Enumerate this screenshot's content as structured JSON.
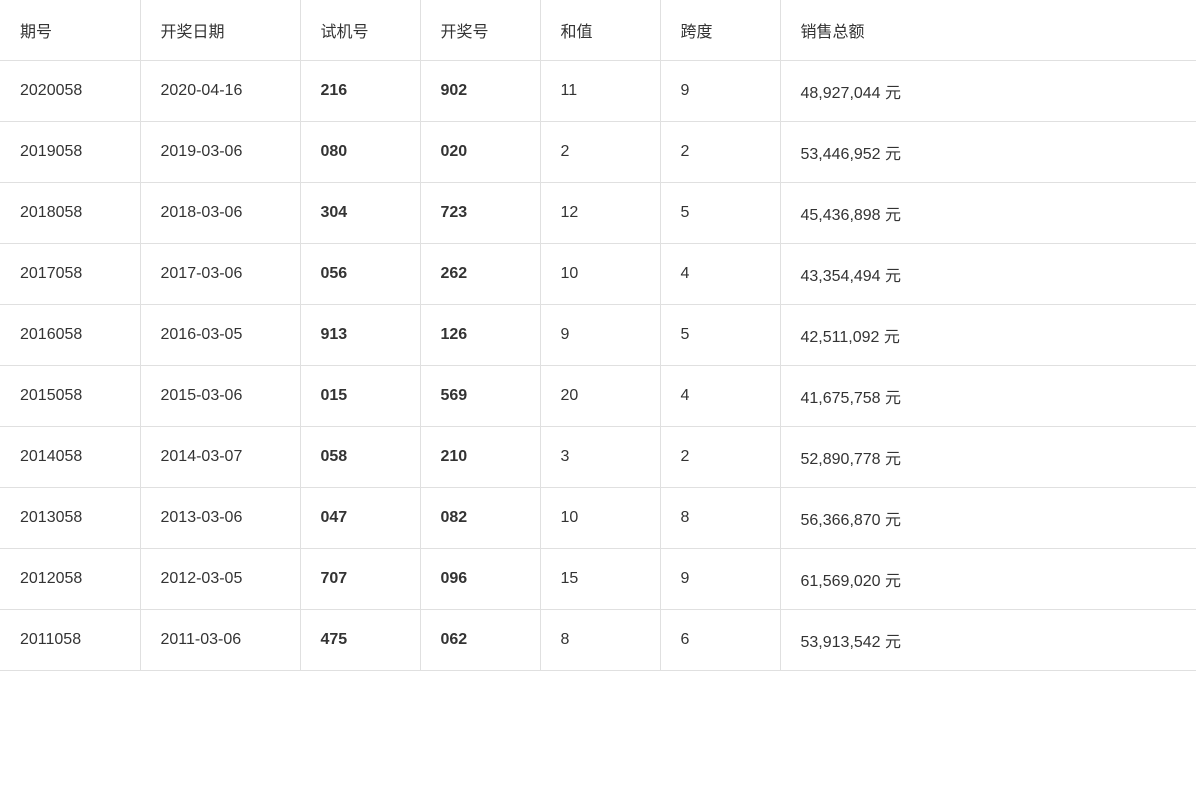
{
  "table": {
    "columns": [
      {
        "id": "qihao",
        "label": "期号"
      },
      {
        "id": "date",
        "label": "开奖日期"
      },
      {
        "id": "shijihao",
        "label": "试机号"
      },
      {
        "id": "kaijianghao",
        "label": "开奖号"
      },
      {
        "id": "hezhi",
        "label": "和值"
      },
      {
        "id": "kuadu",
        "label": "跨度"
      },
      {
        "id": "xiaoshou",
        "label": "销售总额"
      }
    ],
    "rows": [
      {
        "qihao": "2020058",
        "date": "2020-04-16",
        "shijihao": "216",
        "kaijianghao": "902",
        "hezhi": "11",
        "kuadu": "9",
        "xiaoshou": "48,927,044 元"
      },
      {
        "qihao": "2019058",
        "date": "2019-03-06",
        "shijihao": "080",
        "kaijianghao": "020",
        "hezhi": "2",
        "kuadu": "2",
        "xiaoshou": "53,446,952 元"
      },
      {
        "qihao": "2018058",
        "date": "2018-03-06",
        "shijihao": "304",
        "kaijianghao": "723",
        "hezhi": "12",
        "kuadu": "5",
        "xiaoshou": "45,436,898 元"
      },
      {
        "qihao": "2017058",
        "date": "2017-03-06",
        "shijihao": "056",
        "kaijianghao": "262",
        "hezhi": "10",
        "kuadu": "4",
        "xiaoshou": "43,354,494 元"
      },
      {
        "qihao": "2016058",
        "date": "2016-03-05",
        "shijihao": "913",
        "kaijianghao": "126",
        "hezhi": "9",
        "kuadu": "5",
        "xiaoshou": "42,511,092 元"
      },
      {
        "qihao": "2015058",
        "date": "2015-03-06",
        "shijihao": "015",
        "kaijianghao": "569",
        "hezhi": "20",
        "kuadu": "4",
        "xiaoshou": "41,675,758 元"
      },
      {
        "qihao": "2014058",
        "date": "2014-03-07",
        "shijihao": "058",
        "kaijianghao": "210",
        "hezhi": "3",
        "kuadu": "2",
        "xiaoshou": "52,890,778 元"
      },
      {
        "qihao": "2013058",
        "date": "2013-03-06",
        "shijihao": "047",
        "kaijianghao": "082",
        "hezhi": "10",
        "kuadu": "8",
        "xiaoshou": "56,366,870 元"
      },
      {
        "qihao": "2012058",
        "date": "2012-03-05",
        "shijihao": "707",
        "kaijianghao": "096",
        "hezhi": "15",
        "kuadu": "9",
        "xiaoshou": "61,569,020 元"
      },
      {
        "qihao": "2011058",
        "date": "2011-03-06",
        "shijihao": "475",
        "kaijianghao": "062",
        "hezhi": "8",
        "kuadu": "6",
        "xiaoshou": "53,913,542 元"
      }
    ]
  }
}
